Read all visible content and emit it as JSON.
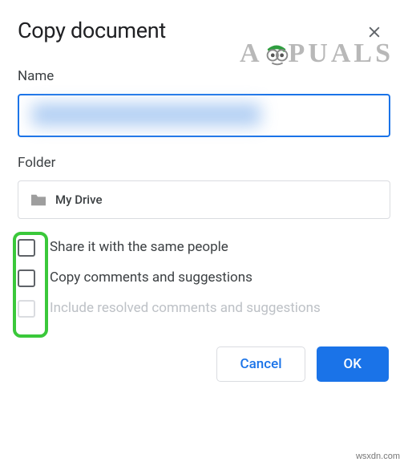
{
  "dialog": {
    "title": "Copy document",
    "name_label": "Name",
    "name_value": "",
    "folder_label": "Folder",
    "folder_value": "My Drive",
    "checkboxes": [
      {
        "label": "Share it with the same people",
        "checked": false,
        "disabled": false
      },
      {
        "label": "Copy comments and suggestions",
        "checked": false,
        "disabled": false
      },
      {
        "label": "Include resolved comments and suggestions",
        "checked": false,
        "disabled": true
      }
    ],
    "cancel_label": "Cancel",
    "ok_label": "OK"
  },
  "watermark": {
    "prefix": "A",
    "suffix": "PUALS"
  },
  "attribution": "wsxdn.com"
}
